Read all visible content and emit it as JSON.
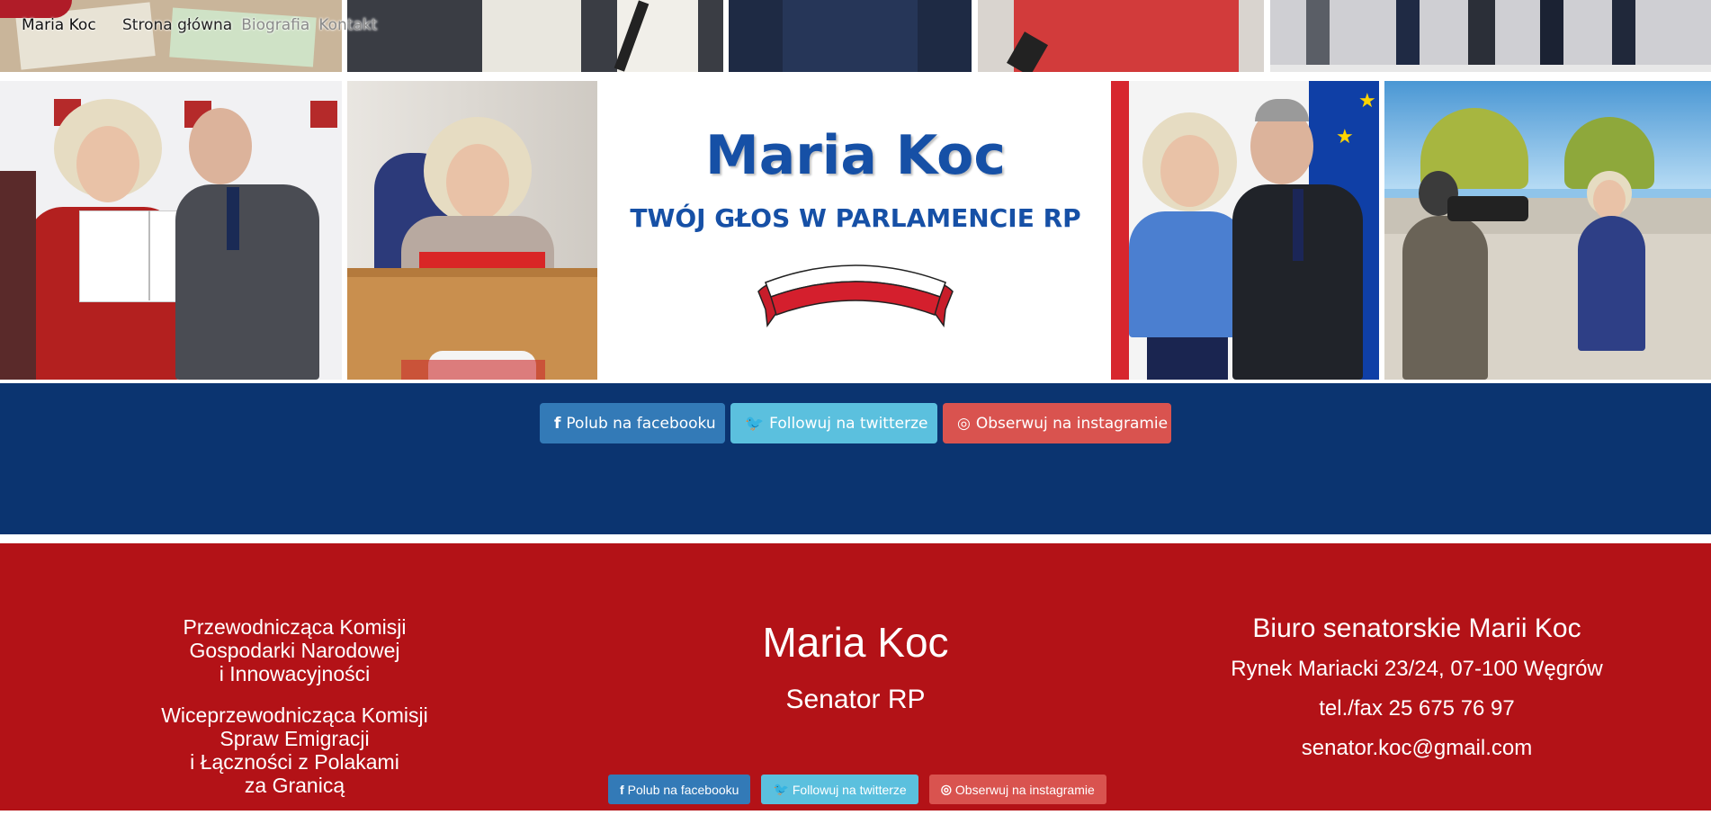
{
  "nav": {
    "brand": "Maria Koc",
    "links": [
      "Strona główna",
      "Biografia",
      "Kontakt"
    ]
  },
  "banner": {
    "title": "Maria Koc",
    "subtitle": "TWÓJ GŁOS W PARLAMENCIE RP"
  },
  "social_top": {
    "facebook": "Polub na facebooku",
    "twitter": "Followuj na twitterze",
    "instagram": "Obserwuj na instagramie"
  },
  "footer": {
    "left_block_1": "Przewodnicząca Komisji\nGospodarki Narodowej\ni Innowacyjności",
    "left_block_2": "Wiceprzewodnicząca Komisji\nSpraw Emigracji\ni Łączności z Polakami\nza Granicą",
    "name": "Maria Koc",
    "role": "Senator RP",
    "office_title": "Biuro senatorskie Marii Koc",
    "address": "Rynek Mariacki 23/24, 07-100 Węgrów",
    "phone": "tel./fax 25 675 76 97",
    "email": "senator.koc@gmail.com"
  },
  "social_bottom": {
    "facebook": "Polub na facebooku",
    "twitter": "Followuj na twitterze",
    "instagram": "Obserwuj na instagramie"
  },
  "colors": {
    "navy_band": "#0b3470",
    "footer_red": "#b31217",
    "banner_blue": "#1650a6",
    "facebook": "#337ab7",
    "twitter": "#5bc0de",
    "instagram": "#d9534f"
  }
}
